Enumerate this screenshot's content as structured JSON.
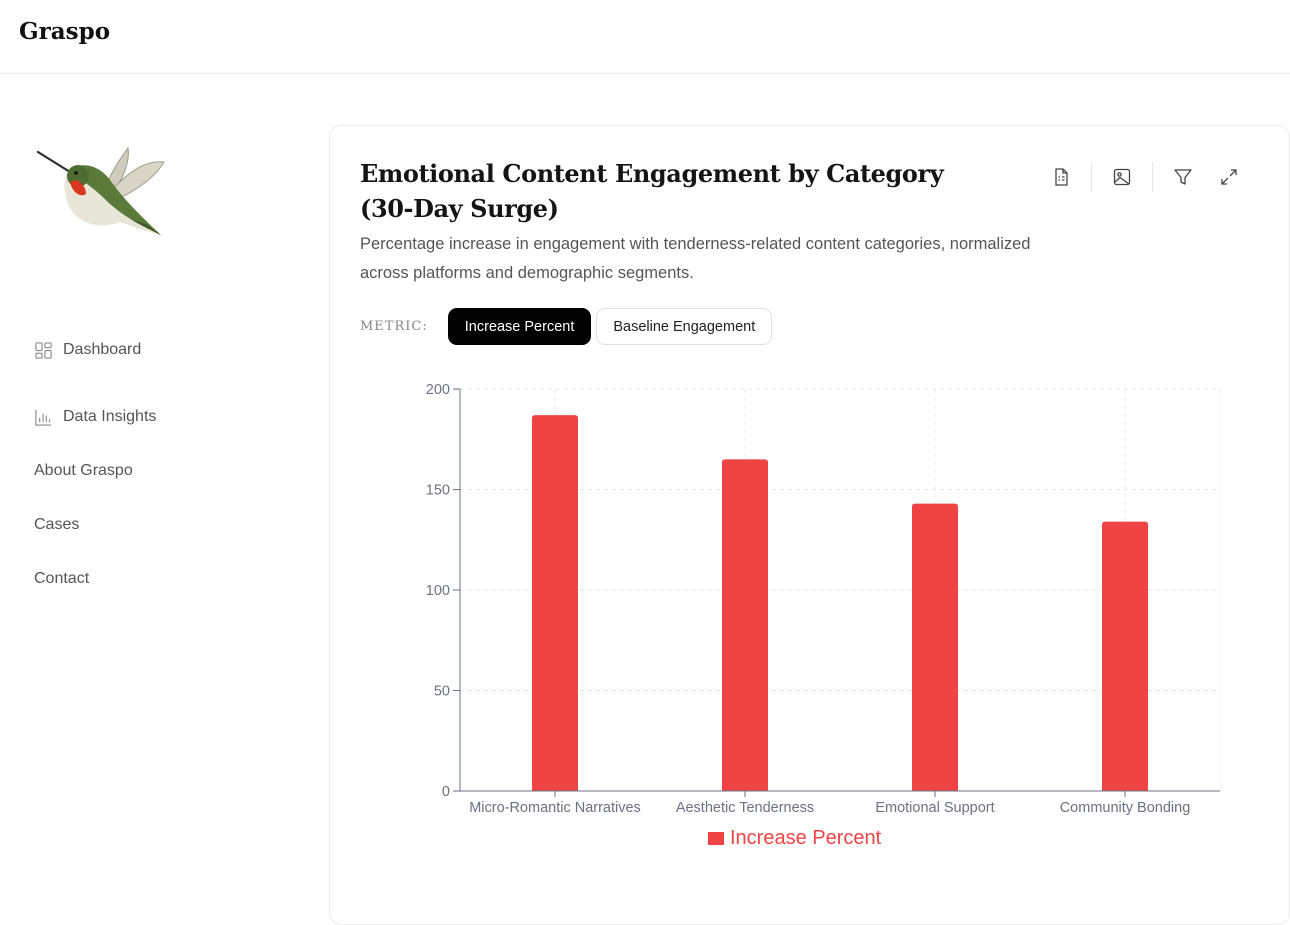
{
  "app": {
    "brand": "Graspo"
  },
  "sidebar": {
    "items": [
      {
        "label": "Dashboard",
        "icon": "dashboard-icon"
      },
      {
        "label": "Data Insights",
        "icon": "bar-chart-icon"
      },
      {
        "label": "About Graspo"
      },
      {
        "label": "Cases"
      },
      {
        "label": "Contact"
      }
    ]
  },
  "card": {
    "title": "Emotional Content Engagement by Category (30-Day Surge)",
    "subtitle": "Percentage increase in engagement with tenderness-related content categories, normalized across platforms and demographic segments.",
    "toolbar": [
      "document-icon",
      "image-icon",
      "filter-icon",
      "expand-icon"
    ],
    "metric_label": "METRIC:",
    "metrics": [
      {
        "label": "Increase Percent",
        "active": true
      },
      {
        "label": "Baseline Engagement",
        "active": false
      }
    ]
  },
  "colors": {
    "bar": "#ef4444",
    "axis": "#6b7280",
    "grid": "#e5e7eb"
  },
  "chart_data": {
    "type": "bar",
    "categories": [
      "Micro-Romantic Narratives",
      "Aesthetic Tenderness",
      "Emotional Support",
      "Community Bonding"
    ],
    "series": [
      {
        "name": "Increase Percent",
        "values": [
          187,
          165,
          143,
          134
        ]
      }
    ],
    "ylim": [
      0,
      200
    ],
    "yticks": [
      0,
      50,
      100,
      150,
      200
    ],
    "grid": true,
    "legend": "bottom-center"
  }
}
